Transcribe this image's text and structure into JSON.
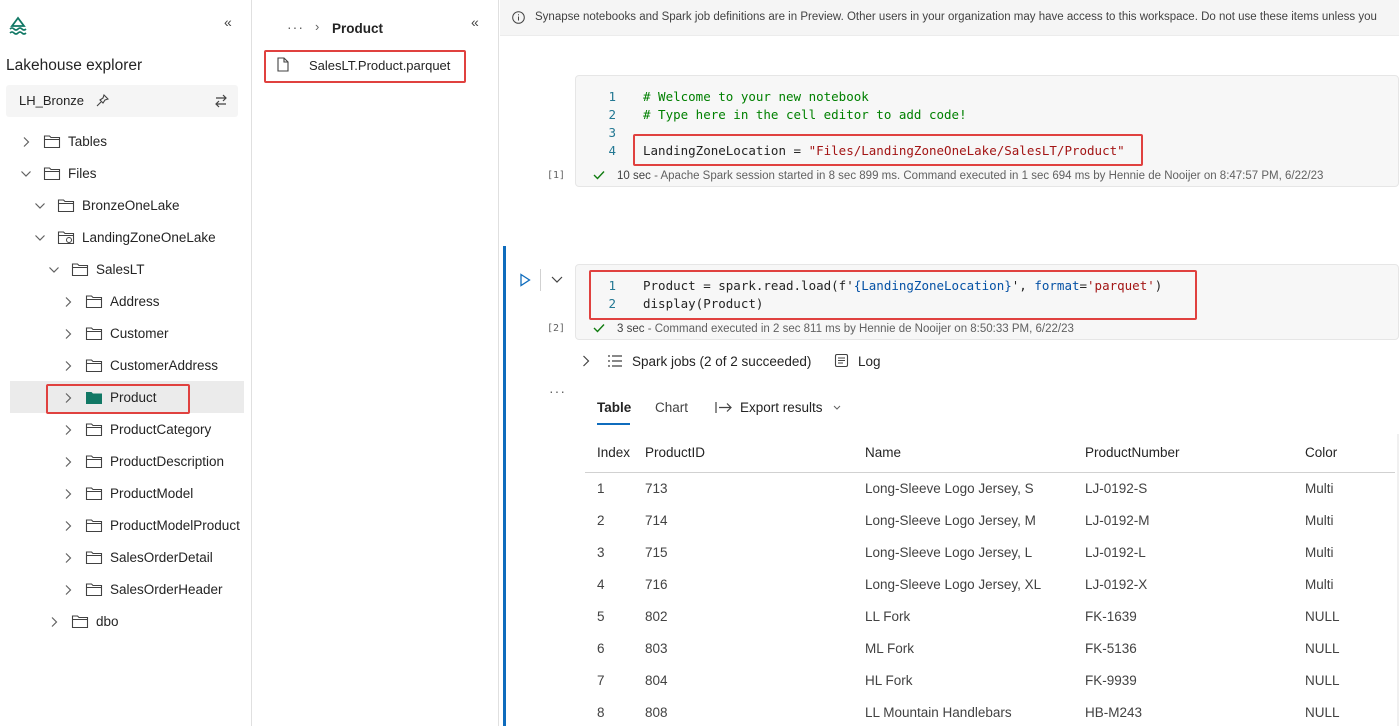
{
  "explorer": {
    "title": "Lakehouse explorer",
    "lakehouse": "LH_Bronze",
    "collapse_icon": "double-chevron-left-icon",
    "tree": [
      {
        "label": "Tables",
        "level": 0,
        "expanded": false
      },
      {
        "label": "Files",
        "level": 0,
        "expanded": true
      },
      {
        "label": "BronzeOneLake",
        "level": 1,
        "expanded": true
      },
      {
        "label": "LandingZoneOneLake",
        "level": 1,
        "expanded": true,
        "shortcut": true
      },
      {
        "label": "SalesLT",
        "level": 2,
        "expanded": true
      },
      {
        "label": "Address",
        "level": 3,
        "expanded": false
      },
      {
        "label": "Customer",
        "level": 3,
        "expanded": false
      },
      {
        "label": "CustomerAddress",
        "level": 3,
        "expanded": false
      },
      {
        "label": "Product",
        "level": 3,
        "expanded": false,
        "selected": true
      },
      {
        "label": "ProductCategory",
        "level": 3,
        "expanded": false
      },
      {
        "label": "ProductDescription",
        "level": 3,
        "expanded": false
      },
      {
        "label": "ProductModel",
        "level": 3,
        "expanded": false
      },
      {
        "label": "ProductModelProduct",
        "level": 3,
        "expanded": false
      },
      {
        "label": "SalesOrderDetail",
        "level": 3,
        "expanded": false
      },
      {
        "label": "SalesOrderHeader",
        "level": 3,
        "expanded": false
      },
      {
        "label": "dbo",
        "level": 2,
        "expanded": false
      }
    ]
  },
  "files": {
    "breadcrumb_more": "···",
    "breadcrumb_current": "Product",
    "file_name": "SalesLT.Product.parquet"
  },
  "banner": {
    "text": "Synapse notebooks and Spark job definitions are in Preview. Other users in your organization may have access to this workspace. Do not use these items unless you"
  },
  "cell1": {
    "exec_label": "[1]",
    "lines": [
      {
        "n": "1",
        "code": "# Welcome to your new notebook"
      },
      {
        "n": "2",
        "code": "# Type here in the cell editor to add code!"
      },
      {
        "n": "3",
        "code": ""
      },
      {
        "n": "4",
        "var": "LandingZoneLocation",
        "op": " = ",
        "str": "\"Files/LandingZoneOneLake/SalesLT/Product\""
      }
    ],
    "status_time": "10 sec",
    "status_text": " - Apache Spark session started in 8 sec 899 ms. Command executed in 1 sec 694 ms by Hennie de Nooijer on 8:47:57 PM, 6/22/23"
  },
  "cell2": {
    "exec_label": "[2]",
    "line1": {
      "n": "1",
      "a": "Product = spark.read.load(f'",
      "b": "{LandingZoneLocation}",
      "c": "', ",
      "d": "format",
      "e": "=",
      "f": "'parquet'",
      "g": ")"
    },
    "line2": {
      "n": "2",
      "code": "display(Product)"
    },
    "status_time": "3 sec",
    "status_text": " - Command executed in 2 sec 811 ms by Hennie de Nooijer on 8:50:33 PM, 6/22/23",
    "spark_jobs": "Spark jobs (2 of 2 succeeded)",
    "log": "Log"
  },
  "results": {
    "tabs": [
      "Table",
      "Chart"
    ],
    "export": "Export results",
    "columns": [
      "Index",
      "ProductID",
      "Name",
      "ProductNumber",
      "Color"
    ],
    "rows": [
      [
        "1",
        "713",
        "Long-Sleeve Logo Jersey, S",
        "LJ-0192-S",
        "Multi"
      ],
      [
        "2",
        "714",
        "Long-Sleeve Logo Jersey, M",
        "LJ-0192-M",
        "Multi"
      ],
      [
        "3",
        "715",
        "Long-Sleeve Logo Jersey, L",
        "LJ-0192-L",
        "Multi"
      ],
      [
        "4",
        "716",
        "Long-Sleeve Logo Jersey, XL",
        "LJ-0192-X",
        "Multi"
      ],
      [
        "5",
        "802",
        "LL Fork",
        "FK-1639",
        "NULL"
      ],
      [
        "6",
        "803",
        "ML Fork",
        "FK-5136",
        "NULL"
      ],
      [
        "7",
        "804",
        "HL Fork",
        "FK-9939",
        "NULL"
      ],
      [
        "8",
        "808",
        "LL Mountain Handlebars",
        "HB-M243",
        "NULL"
      ]
    ]
  },
  "colors": {
    "accent": "#0f6cbd",
    "highlight": "#e0413f",
    "folder_selected": "#117865",
    "success": "#107c10"
  }
}
